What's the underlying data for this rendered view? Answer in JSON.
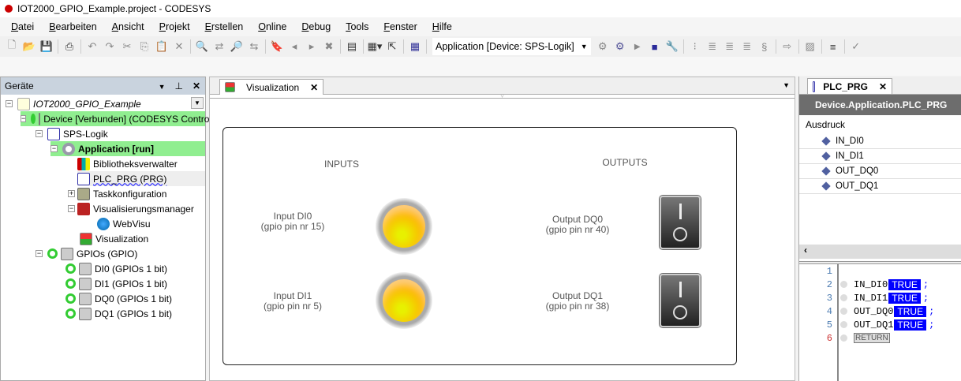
{
  "window": {
    "title": "IOT2000_GPIO_Example.project - CODESYS"
  },
  "menu": [
    "Datei",
    "Bearbeiten",
    "Ansicht",
    "Projekt",
    "Erstellen",
    "Online",
    "Debug",
    "Tools",
    "Fenster",
    "Hilfe"
  ],
  "toolbar": {
    "application_selector": "Application [Device: SPS-Logik]"
  },
  "devices_panel": {
    "title": "Geräte",
    "tree": [
      {
        "label": "IOT2000_GPIO_Example",
        "level": 0,
        "italic": true
      },
      {
        "label": "Device [Verbunden] (CODESYS Control",
        "level": 1,
        "highlight": true
      },
      {
        "label": "SPS-Logik",
        "level": 2
      },
      {
        "label": "Application [run]",
        "level": 3,
        "highlight": true,
        "bold": true
      },
      {
        "label": "Bibliotheksverwalter",
        "level": 4
      },
      {
        "label": "PLC_PRG (PRG)",
        "level": 4,
        "selected": true
      },
      {
        "label": "Taskkonfiguration",
        "level": 4
      },
      {
        "label": "Visualisierungsmanager",
        "level": 4
      },
      {
        "label": "WebVisu",
        "level": 5
      },
      {
        "label": "Visualization",
        "level": 4
      },
      {
        "label": "GPIOs (GPIO)",
        "level": 2
      },
      {
        "label": "DI0 (GPIOs 1 bit)",
        "level": 3
      },
      {
        "label": "DI1 (GPIOs 1 bit)",
        "level": 3
      },
      {
        "label": "DQ0 (GPIOs 1 bit)",
        "level": 3
      },
      {
        "label": "DQ1 (GPIOs 1 bit)",
        "level": 3
      }
    ]
  },
  "editor": {
    "tab": "Visualization",
    "inputs_title": "INPUTS",
    "outputs_title": "OUTPUTS",
    "inputs": [
      {
        "label": "Input DI0",
        "pin": "(gpio pin nr 15)",
        "lamp_on": true
      },
      {
        "label": "Input DI1",
        "pin": "(gpio pin nr 5)",
        "lamp_on": true
      }
    ],
    "outputs": [
      {
        "label": "Output DQ0",
        "pin": "(gpio pin nr 40)",
        "switch_on": false
      },
      {
        "label": "Output DQ1",
        "pin": "(gpio pin nr 38)",
        "switch_on": false
      }
    ]
  },
  "plc_prg": {
    "tab": "PLC_PRG",
    "header": "Device.Application.PLC_PRG",
    "column": "Ausdruck",
    "watch": [
      "IN_DI0",
      "IN_DI1",
      "OUT_DQ0",
      "OUT_DQ1"
    ],
    "code": [
      {
        "n": "1",
        "text": "",
        "value": ""
      },
      {
        "n": "2",
        "text": "IN_DI0",
        "value": "TRUE"
      },
      {
        "n": "3",
        "text": "IN_DI1",
        "value": "TRUE"
      },
      {
        "n": "4",
        "text": "OUT_DQ0",
        "value": "TRUE"
      },
      {
        "n": "5",
        "text": "OUT_DQ1",
        "value": "TRUE"
      },
      {
        "n": "6",
        "text": "RETURN",
        "value": ""
      }
    ],
    "semicolon": ";"
  },
  "colors": {
    "highlight": "#90ee90",
    "online_value": "#0000ff",
    "header": "#6d6d6d"
  }
}
